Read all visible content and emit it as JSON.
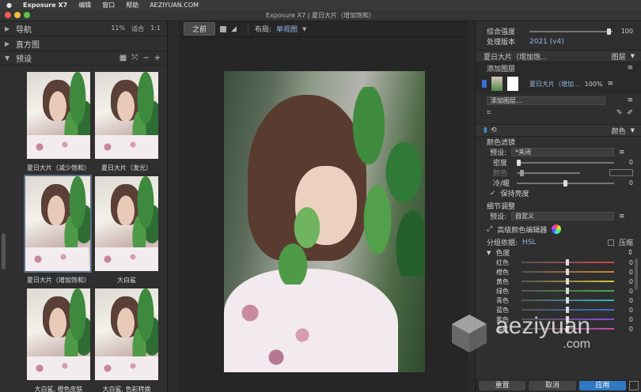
{
  "menubar": {
    "apple": "",
    "app": "Exposure X7",
    "items": [
      "编辑",
      "窗口",
      "帮助"
    ],
    "url": "AEZIYUAN.COM"
  },
  "window": {
    "title": "Exposure X7 | 夏日大片（增加饱和）"
  },
  "left": {
    "nav": {
      "label": "导航",
      "zoom": "11%",
      "fit": "适合",
      "ratio": "1:1"
    },
    "histogram": {
      "label": "直方图"
    },
    "presets": {
      "label": "预设"
    },
    "thumbs": [
      {
        "label": "夏日大片（减少饱和）"
      },
      {
        "label": "夏日大片（发光）"
      },
      {
        "label": "夏日大片（增加饱和）"
      },
      {
        "label": "大白鲨"
      },
      {
        "label": "大白鲨, 橙色皮肤"
      },
      {
        "label": "大白鲨, 色彩转换"
      }
    ]
  },
  "center": {
    "before_label": "之前",
    "layout_label": "布局:",
    "layout_value": "单视图"
  },
  "right": {
    "strength": {
      "label": "综合强度",
      "value": "100",
      "pos": 0.93
    },
    "version": {
      "label": "处理版本",
      "value": "2021 (v4)"
    },
    "layers_header": {
      "left": "夏日大片（增加饱...",
      "right": "图层"
    },
    "add_layer_top": "添加图层",
    "layer": {
      "name": "夏日大片（增加...",
      "opacity": "100%"
    },
    "add_layer_dropdown": "添加图层...",
    "color_header": "颜色",
    "color_filter": {
      "title": "颜色滤镜",
      "preset_label": "预设:",
      "preset_value": "*关闭",
      "density_label": "密度",
      "density_value": "0",
      "color_label": "颜色",
      "warmcool_label": "冷/暖",
      "warmcool_value": "0",
      "keep_brightness": "保持亮度"
    },
    "detail": {
      "title": "细节调整",
      "preset_label": "预设:",
      "preset_value": "自定义"
    },
    "advanced_editor": "高级颜色编辑器",
    "group_by": {
      "label": "分组依据:",
      "value": "HSL",
      "compress": "压缩"
    },
    "hue_label": "色度",
    "hsl": [
      {
        "label": "红色",
        "value": "0",
        "color": "#d64545"
      },
      {
        "label": "橙色",
        "value": "0",
        "color": "#d9822b"
      },
      {
        "label": "黄色",
        "value": "0",
        "color": "#d4c531"
      },
      {
        "label": "绿色",
        "value": "0",
        "color": "#4aa84a"
      },
      {
        "label": "青色",
        "value": "0",
        "color": "#31b6c4"
      },
      {
        "label": "蓝色",
        "value": "0",
        "color": "#3a6fd6"
      },
      {
        "label": "紫色",
        "value": "0",
        "color": "#8a4ad6"
      },
      {
        "label": "品红",
        "value": "0",
        "color": "#c44ab0"
      }
    ],
    "buttons": {
      "reset": "重置",
      "cancel": "取消",
      "apply": "应用"
    }
  },
  "watermark": {
    "line1": "aeziyuan",
    "line2": ".com"
  }
}
